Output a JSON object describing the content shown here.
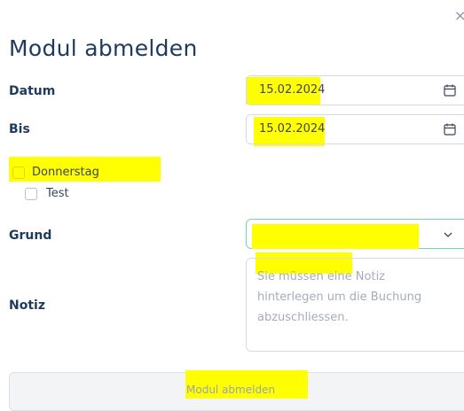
{
  "dialog": {
    "title": "Modul abmelden",
    "close_glyph": "×"
  },
  "form": {
    "date_from": {
      "label": "Datum",
      "value": "15.02.2024",
      "icon": "calendar-icon"
    },
    "date_to": {
      "label": "Bis",
      "value": "15.02.2024",
      "icon": "calendar-icon"
    },
    "days": [
      {
        "label": "Donnerstag",
        "checked": false
      },
      {
        "label": "Test",
        "checked": false
      }
    ],
    "reason": {
      "label": "Grund",
      "value": "",
      "icon": "chevron-down-icon"
    },
    "note": {
      "label": "Notiz",
      "placeholder": "Sie müssen eine Notiz hinterlegen um die Buchung abzuschliessen."
    },
    "submit_label": "Modul abmelden"
  },
  "colors": {
    "title": "#1e3a5f",
    "highlight": "#ffff00",
    "select_border": "#7fd0b2",
    "placeholder": "#a5adb9",
    "button_bg": "#f3f4f6"
  }
}
